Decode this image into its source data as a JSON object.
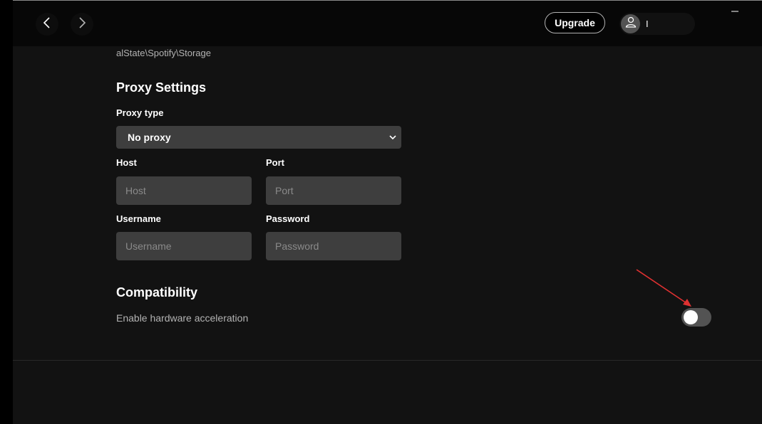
{
  "topbar": {
    "upgrade_label": "Upgrade",
    "user_name": "I"
  },
  "storage": {
    "path_text": "alState\\Spotify\\Storage"
  },
  "proxy": {
    "title": "Proxy Settings",
    "type_label": "Proxy type",
    "type_selected": "No proxy",
    "host_label": "Host",
    "host_placeholder": "Host",
    "port_label": "Port",
    "port_placeholder": "Port",
    "username_label": "Username",
    "username_placeholder": "Username",
    "password_label": "Password",
    "password_placeholder": "Password"
  },
  "compatibility": {
    "title": "Compatibility",
    "hardware_acceleration_label": "Enable hardware acceleration",
    "hardware_acceleration_enabled": false
  },
  "icons": {
    "back": "chevron-left-icon",
    "forward": "chevron-right-icon",
    "user": "user-icon",
    "dropdown": "chevron-down-icon",
    "minimize": "minimize-icon"
  },
  "colors": {
    "background": "#121212",
    "topbar": "#070707",
    "input_bg": "#3e3e3e",
    "annotation_arrow": "#e03131"
  }
}
